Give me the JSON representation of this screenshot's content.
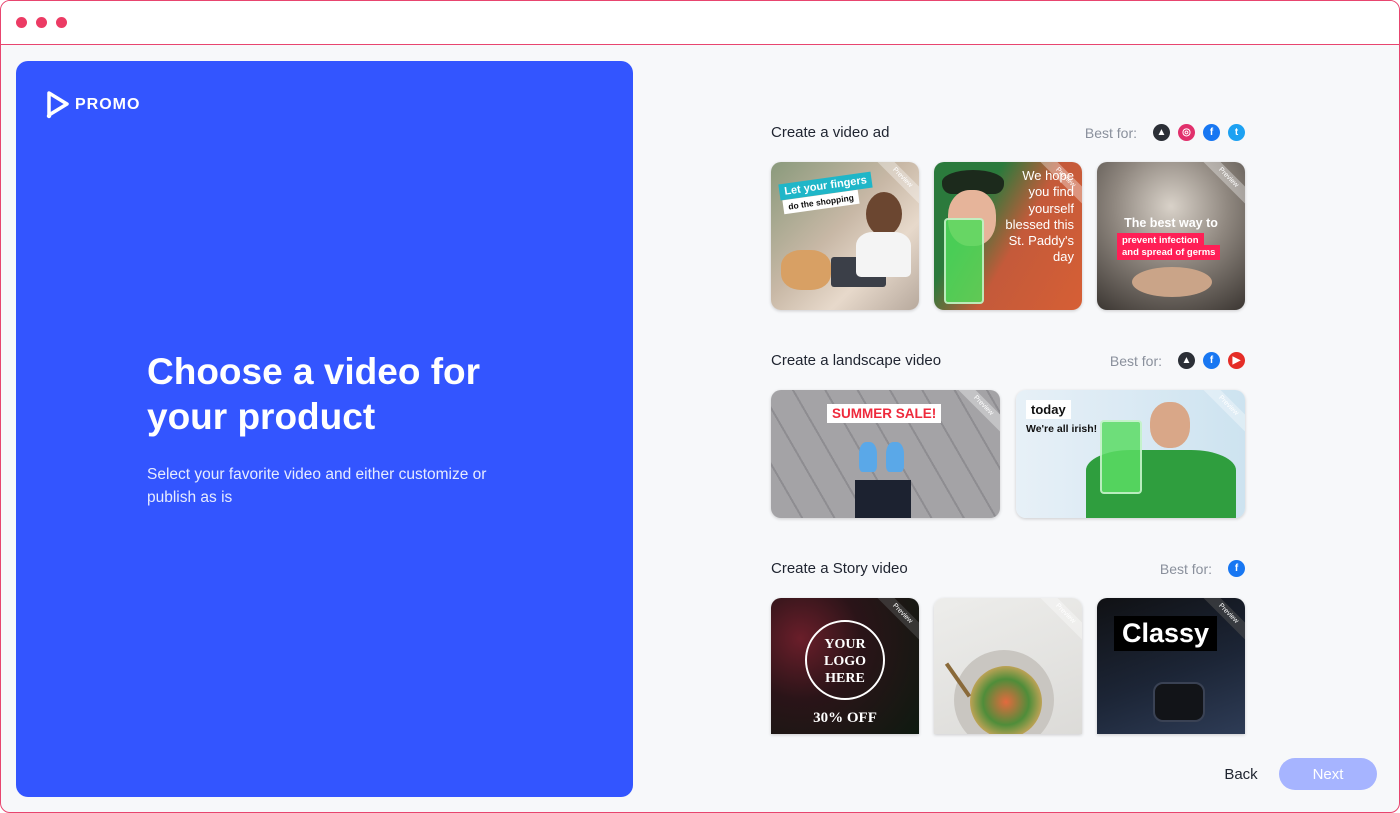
{
  "brand": {
    "name": "PROMO"
  },
  "intro": {
    "headline": "Choose a video for your product",
    "subtitle": "Select your favorite video and either customize or publish as is"
  },
  "best_for_label": "Best for:",
  "ribbon_label": "Preview",
  "sections": [
    {
      "title": "Create a video ad",
      "platforms": [
        "promo-icon",
        "instagram-icon",
        "facebook-icon",
        "twitter-icon"
      ],
      "thumbnails": [
        {
          "lines": [
            "Let your fingers",
            "do the shopping"
          ]
        },
        {
          "lines": [
            "We hope",
            "you find",
            "yourself",
            "blessed this",
            "St. Paddy's",
            "day"
          ]
        },
        {
          "lines": [
            "The best way to",
            "prevent infection",
            "and spread of germs"
          ]
        }
      ]
    },
    {
      "title": "Create a landscape video",
      "platforms": [
        "promo-icon",
        "facebook-icon",
        "youtube-icon"
      ],
      "thumbnails": [
        {
          "lines": [
            "SUMMER SALE!"
          ]
        },
        {
          "lines": [
            "today",
            "We're all irish!"
          ]
        }
      ]
    },
    {
      "title": "Create a Story video",
      "platforms": [
        "facebook-icon"
      ],
      "thumbnails": [
        {
          "lines": [
            "YOUR",
            "LOGO",
            "HERE",
            "30% OFF"
          ]
        },
        {
          "lines": []
        },
        {
          "lines": [
            "Classy"
          ]
        }
      ]
    }
  ],
  "footer": {
    "back_label": "Back",
    "next_label": "Next"
  },
  "colors": {
    "accent": "#3355ff",
    "next_disabled": "#a6b4ff",
    "frame": "#e8456f"
  }
}
